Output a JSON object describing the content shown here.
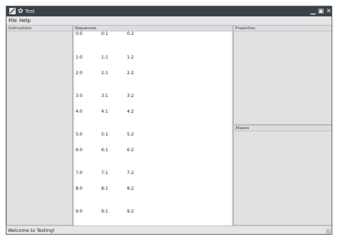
{
  "window": {
    "title": "Test"
  },
  "menu": {
    "file": "File",
    "help": "Help"
  },
  "panels": {
    "instructions": "Instructions",
    "sequences": "Sequences",
    "properties": "Properties",
    "aliases": "Aliases"
  },
  "sequences": {
    "rows": [
      [
        "0:0",
        "0:1",
        "0:2"
      ],
      [
        "1:0",
        "1:1",
        "1:2"
      ],
      [
        "2:0",
        "2:1",
        "2:2"
      ],
      [
        "3:0",
        "3:1",
        "3:2"
      ],
      [
        "4:0",
        "4:1",
        "4:2"
      ],
      [
        "5:0",
        "5:1",
        "5:2"
      ],
      [
        "6:0",
        "6:1",
        "6:2"
      ],
      [
        "7:0",
        "7:1",
        "7:2"
      ],
      [
        "8:0",
        "8:1",
        "8:2"
      ],
      [
        "9:0",
        "9:1",
        "9:2"
      ]
    ]
  },
  "status": {
    "text": "Welcome to Testing!"
  },
  "icons": {
    "app": "app-icon",
    "settings": "gear-icon",
    "minimize": "minimize-icon",
    "maximize": "maximize-icon",
    "close": "close-icon",
    "resize": "resize-grip-icon"
  }
}
